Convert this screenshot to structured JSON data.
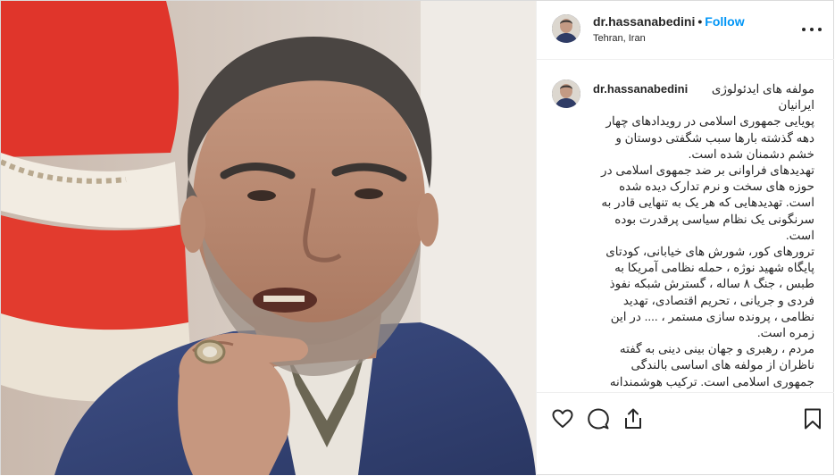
{
  "post": {
    "author": {
      "username": "dr.hassanabedini",
      "location": "Tehran, Iran",
      "follow_label": "Follow",
      "separator": "•"
    },
    "caption": {
      "username": "dr.hassanabedini",
      "text": "مولفه های ایدئولوژی ایرانیان\nپویایی جمهوری اسلامی در رویدادهای چهار دهه گذشته بارها سبب شگفتی دوستان و خشم دشمنان شده است.\nتهدیدهای فراوانی بر ضد جمهوی اسلامی در حوزه های سخت و نرم تدارک دیده شده است. تهدیدهایی که هر یک به تنهایی قادر به سرنگونی یک نظام سیاسی پرقدرت بوده است.\nترورهای کور، شورش های خیابانی، کودتای پایگاه شهید نوژه ، حمله نظامی آمریکا به طبس ، جنگ ۸ ساله ، گسترش شبکه نفوذ فردی و جریانی ، تحریم اقتصادی، تهدید نظامی ، پرونده سازی مستمر ، .... در این زمره است.\nمردم ، رهبری و جهان بینی دینی به گفته ناظران از مولفه های اساسی بالندگی جمهوری اسلامی است. ترکیب هوشمندانه"
    },
    "icons": {
      "like": "heart-icon",
      "comment": "comment-icon",
      "share": "share-icon",
      "save": "bookmark-icon",
      "more": "more-options-icon"
    }
  }
}
